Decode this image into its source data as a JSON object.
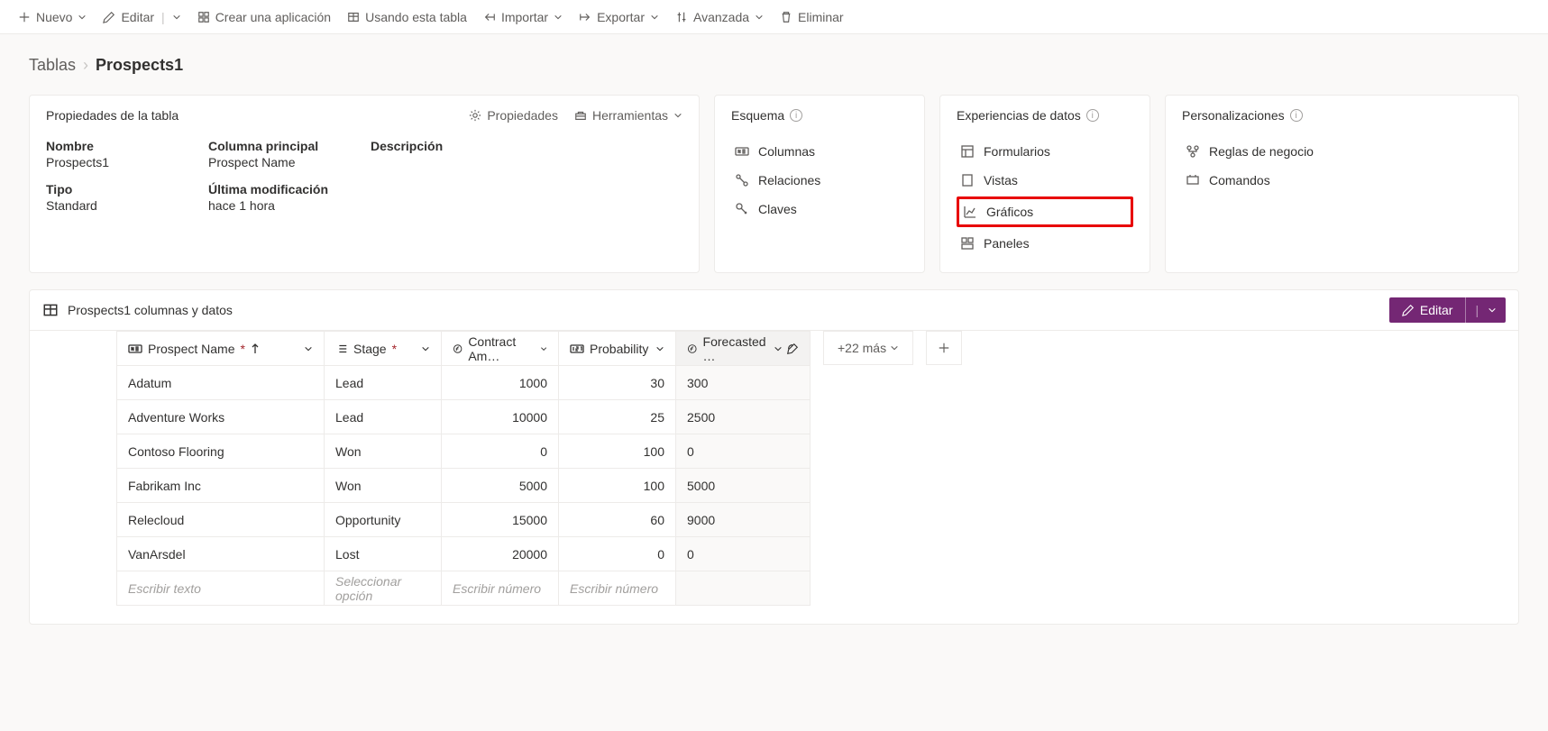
{
  "cmd": {
    "nuevo": "Nuevo",
    "editar": "Editar",
    "crear_app": "Crear una aplicación",
    "usando_tabla": "Usando esta tabla",
    "importar": "Importar",
    "exportar": "Exportar",
    "avanzada": "Avanzada",
    "eliminar": "Eliminar"
  },
  "breadcrumb": {
    "root": "Tablas",
    "current": "Prospects1"
  },
  "props_card": {
    "title": "Propiedades de la tabla",
    "action_props": "Propiedades",
    "action_tools": "Herramientas",
    "labels": {
      "nombre": "Nombre",
      "columna_principal": "Columna principal",
      "descripcion": "Descripción",
      "tipo": "Tipo",
      "ultima_mod": "Última modificación"
    },
    "values": {
      "nombre": "Prospects1",
      "columna_principal": "Prospect Name",
      "descripcion": "",
      "tipo": "Standard",
      "ultima_mod": "hace 1 hora"
    }
  },
  "schema_card": {
    "title": "Esquema",
    "items": {
      "columnas": "Columnas",
      "relaciones": "Relaciones",
      "claves": "Claves"
    }
  },
  "exp_card": {
    "title": "Experiencias de datos",
    "items": {
      "formularios": "Formularios",
      "vistas": "Vistas",
      "graficos": "Gráficos",
      "paneles": "Paneles"
    }
  },
  "cust_card": {
    "title": "Personalizaciones",
    "items": {
      "reglas": "Reglas de negocio",
      "comandos": "Comandos"
    }
  },
  "grid_header": {
    "title": "Prospects1 columnas y datos",
    "edit": "Editar"
  },
  "columns": {
    "name": "Prospect Name",
    "stage": "Stage",
    "amount": "Contract Am…",
    "prob": "Probability",
    "fore": "Forecasted …",
    "more": "+22 más"
  },
  "placeholders": {
    "text": "Escribir texto",
    "option": "Seleccionar opción",
    "number": "Escribir número"
  },
  "rows": [
    {
      "name": "Adatum",
      "stage": "Lead",
      "amount": "1000",
      "prob": "30",
      "fore": "300"
    },
    {
      "name": "Adventure Works",
      "stage": "Lead",
      "amount": "10000",
      "prob": "25",
      "fore": "2500"
    },
    {
      "name": "Contoso Flooring",
      "stage": "Won",
      "amount": "0",
      "prob": "100",
      "fore": "0"
    },
    {
      "name": "Fabrikam Inc",
      "stage": "Won",
      "amount": "5000",
      "prob": "100",
      "fore": "5000"
    },
    {
      "name": "Relecloud",
      "stage": "Opportunity",
      "amount": "15000",
      "prob": "60",
      "fore": "9000"
    },
    {
      "name": "VanArsdel",
      "stage": "Lost",
      "amount": "20000",
      "prob": "0",
      "fore": "0"
    }
  ]
}
